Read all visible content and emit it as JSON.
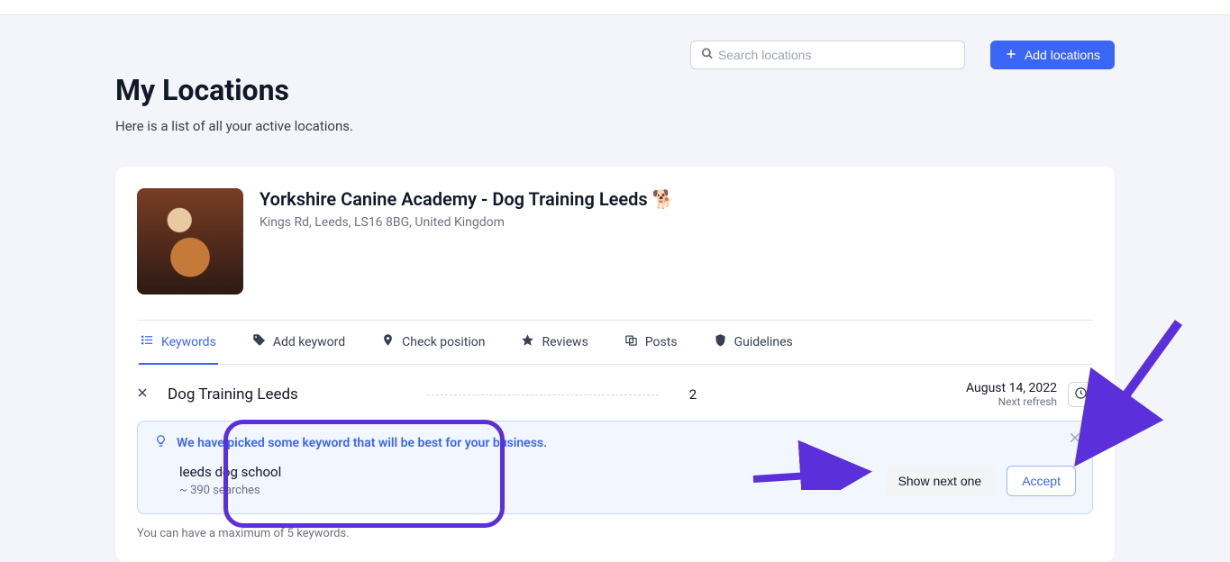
{
  "header": {
    "search_placeholder": "Search locations",
    "add_button": "Add locations"
  },
  "page": {
    "title": "My Locations",
    "subtitle": "Here is a list of all your active locations."
  },
  "location": {
    "name": "Yorkshire Canine Academy - Dog Training Leeds 🐕",
    "address": "Kings Rd, Leeds, LS16 8BG, United Kingdom"
  },
  "tabs": [
    {
      "id": "keywords",
      "label": "Keywords",
      "icon": "list-icon",
      "active": true
    },
    {
      "id": "addkeyword",
      "label": "Add keyword",
      "icon": "tag-icon",
      "active": false
    },
    {
      "id": "checkpos",
      "label": "Check position",
      "icon": "pin-icon",
      "active": false
    },
    {
      "id": "reviews",
      "label": "Reviews",
      "icon": "star-icon",
      "active": false
    },
    {
      "id": "posts",
      "label": "Posts",
      "icon": "post-icon",
      "active": false
    },
    {
      "id": "guidelines",
      "label": "Guidelines",
      "icon": "shield-icon",
      "active": false
    }
  ],
  "keyword_row": {
    "name": "Dog Training Leeds",
    "rank": "2",
    "date": "August 14, 2022",
    "date_sub": "Next refresh"
  },
  "suggestion": {
    "headline": "We have picked some keyword that will be best for your business.",
    "keyword": "leeds dog school",
    "searches": "~ 390 searches",
    "show_next": "Show next one",
    "accept": "Accept"
  },
  "footnote": "You can have a maximum of 5 keywords."
}
